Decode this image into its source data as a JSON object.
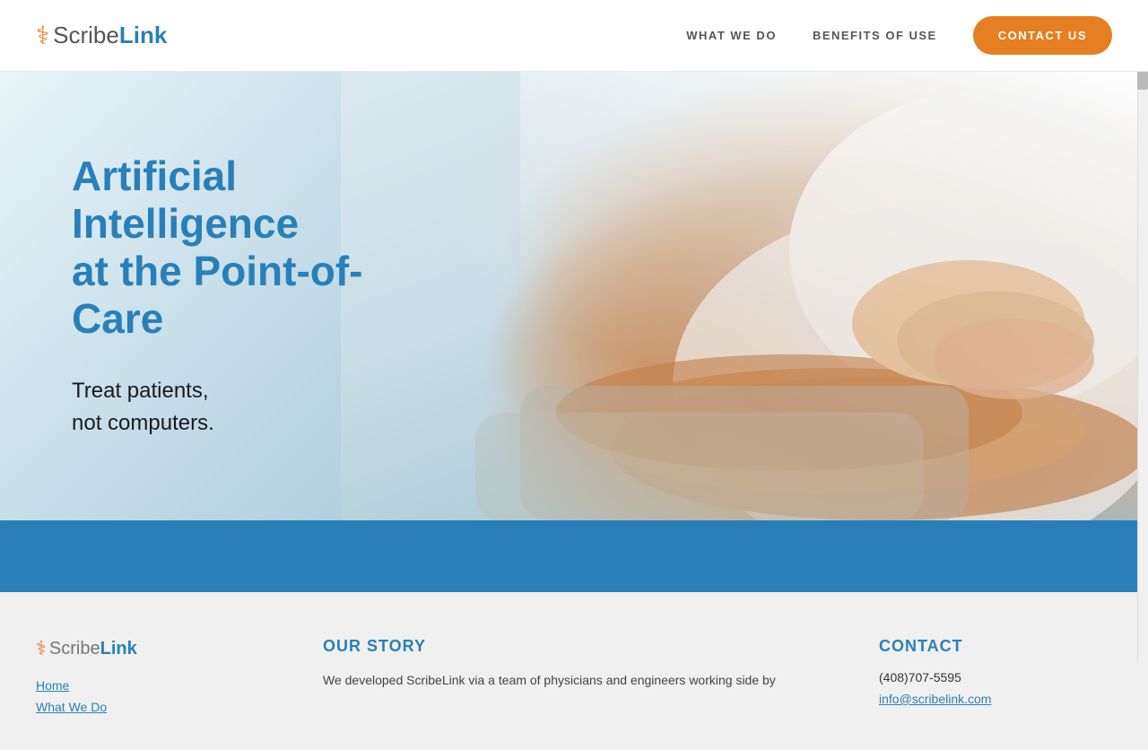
{
  "navbar": {
    "logo": {
      "scribe": "Scribe",
      "link": "Link",
      "icon": "⚕"
    },
    "nav_items": [
      {
        "label": "WHAT WE DO",
        "id": "what-we-do"
      },
      {
        "label": "BENEFITS OF USE",
        "id": "benefits"
      }
    ],
    "contact_button": "CONTACT US"
  },
  "hero": {
    "headline_line1": "Artificial Intelligence",
    "headline_line2": "at the Point-of-Care",
    "subtext_line1": "Treat patients,",
    "subtext_line2": "not computers."
  },
  "footer": {
    "logo": {
      "scribe": "Scribe",
      "link": "Link",
      "icon": "⚕"
    },
    "nav_links": [
      {
        "label": "Home"
      },
      {
        "label": "What We Do"
      }
    ],
    "our_story": {
      "title": "OUR STORY",
      "text": "We developed ScribeLink via a team of physicians and engineers working side by"
    },
    "contact": {
      "title": "CONTACT",
      "phone": "(408)707-5595",
      "email": "info@scribelink.com"
    }
  }
}
